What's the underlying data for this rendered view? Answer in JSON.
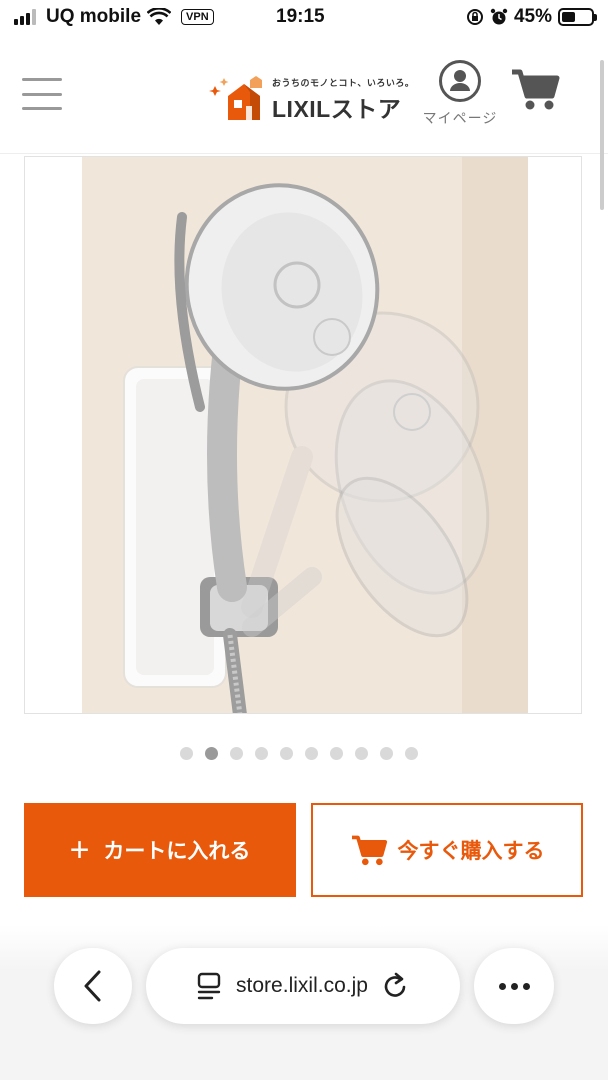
{
  "status_bar": {
    "carrier": "UQ mobile",
    "vpn": "VPN",
    "time": "19:15",
    "battery_percent": "45%",
    "battery_level": 0.45
  },
  "header": {
    "logo_tagline": "おうちのモノとコト、いろいろ。",
    "logo_name": "LIXILストア",
    "mypage_label": "マイページ"
  },
  "carousel": {
    "total": 10,
    "active_index": 1
  },
  "actions": {
    "add_to_cart": "カートに入れる",
    "buy_now": "今すぐ購入する"
  },
  "browser": {
    "url": "store.lixil.co.jp"
  },
  "colors": {
    "accent": "#e8590c"
  }
}
